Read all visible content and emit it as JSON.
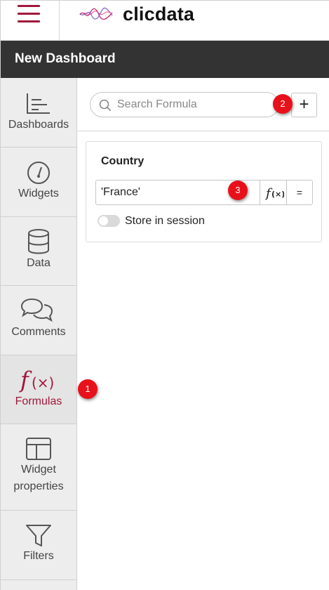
{
  "app": {
    "brand": "clicdata"
  },
  "header": {
    "title": "New Dashboard"
  },
  "sidebar": {
    "items": [
      {
        "label": "Dashboards",
        "icon": "dashboards-chart-icon",
        "active": false
      },
      {
        "label": "Widgets",
        "icon": "gauge-icon",
        "active": false
      },
      {
        "label": "Data",
        "icon": "database-icon",
        "active": false
      },
      {
        "label": "Comments",
        "icon": "chat-bubbles-icon",
        "active": false
      },
      {
        "label": "Formulas",
        "icon": "fx-icon",
        "active": true
      },
      {
        "label_line1": "Widget",
        "label_line2": "properties",
        "icon": "layout-icon",
        "active": false
      },
      {
        "label": "Filters",
        "icon": "funnel-icon",
        "active": false
      }
    ]
  },
  "search": {
    "placeholder": "Search Formula",
    "value": ""
  },
  "toolbar": {
    "add_label": "+"
  },
  "formula": {
    "name": "Country",
    "value": "'France'",
    "fx_label": "f(x)",
    "eq_label": "=",
    "store_label": "Store in session",
    "store_enabled": false
  },
  "markers": [
    "1",
    "2",
    "3"
  ],
  "colors": {
    "accent": "#a0173a",
    "titlebar": "#333333",
    "marker": "#e8101a",
    "sidebar_bg": "#ededed"
  }
}
